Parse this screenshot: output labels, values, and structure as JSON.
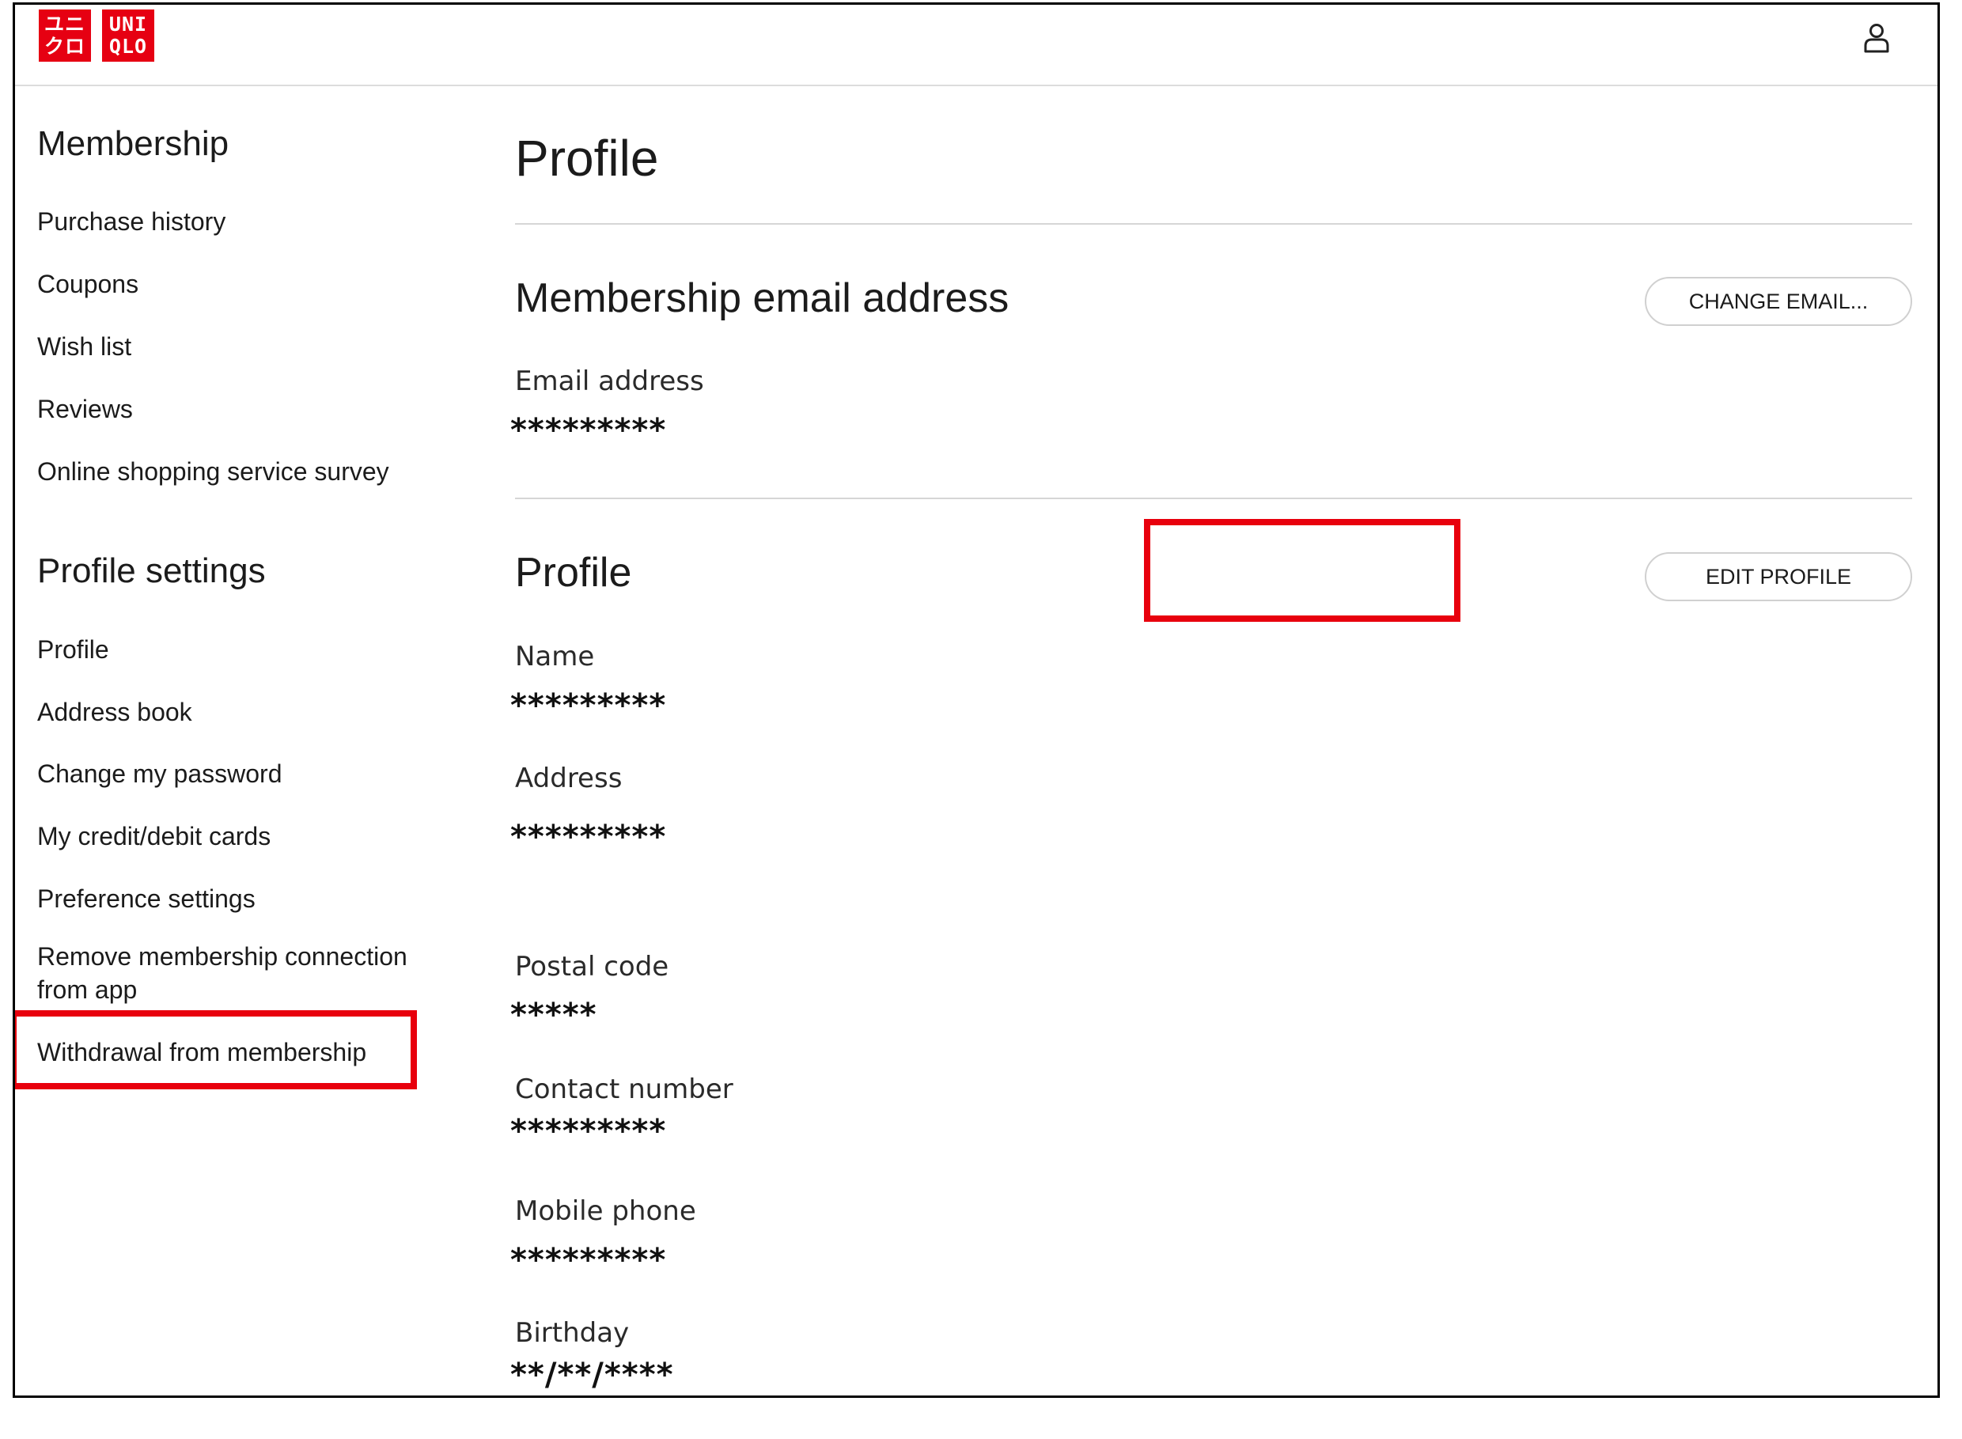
{
  "brand": {
    "logo_left": [
      "ユニ",
      "クロ"
    ],
    "logo_right": [
      "UNI",
      "QLO"
    ],
    "brand_color": "#e60012"
  },
  "header": {
    "account_icon": "user-icon"
  },
  "sidebar": {
    "membership_heading": "Membership",
    "membership_items": [
      {
        "label": "Purchase history"
      },
      {
        "label": "Coupons"
      },
      {
        "label": "Wish list"
      },
      {
        "label": "Reviews"
      },
      {
        "label": "Online shopping service survey"
      }
    ],
    "profile_heading": "Profile settings",
    "profile_items": [
      {
        "label": "Profile"
      },
      {
        "label": "Address book"
      },
      {
        "label": "Change my password"
      },
      {
        "label": "My credit/debit cards"
      },
      {
        "label": "Preference settings"
      },
      {
        "label": "Remove membership connection from app"
      },
      {
        "label": "Withdrawal from membership"
      }
    ]
  },
  "main": {
    "page_title": "Profile",
    "email_section": {
      "title": "Membership email address",
      "button": "CHANGE EMAIL...",
      "email_label": "Email address",
      "email_value": "*********"
    },
    "profile_section": {
      "title": "Profile",
      "button": "EDIT PROFILE",
      "fields": [
        {
          "label": "Name",
          "value": "*********"
        },
        {
          "label": "Address",
          "value": "*********"
        },
        {
          "label": "Postal code",
          "value": "*****"
        },
        {
          "label": "Contact number",
          "value": "*********"
        },
        {
          "label": "Mobile phone",
          "value": "*********"
        },
        {
          "label": "Birthday",
          "value": "**/**/****"
        }
      ]
    }
  },
  "annotations": {
    "highlight_color": "#e8000d"
  }
}
